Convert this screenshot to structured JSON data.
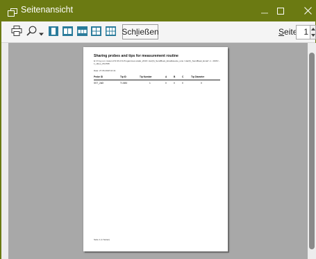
{
  "window": {
    "title": "Seitenansicht",
    "icons": {
      "app": "print-preview-icon",
      "minimize": "minimize-icon",
      "maximize": "maximize-icon",
      "close": "close-icon"
    }
  },
  "toolbar": {
    "icons": [
      "print-icon",
      "zoom-icon",
      "chevron-down-icon",
      "one-page-icon",
      "two-pages-icon",
      "three-pages-icon",
      "four-pages-icon",
      "six-pages-icon"
    ],
    "close_label_prefix": "Sch",
    "close_label_mnemonic": "l",
    "close_label_suffix": "ießen",
    "page_label_mnemonic": "S",
    "page_label_suffix": "eite",
    "page_value": "1"
  },
  "document": {
    "title": "Sharing probes and tips for measurement routine",
    "path": "E:\\ P.xyy.u.m.mssum.FS.SS.0.S.Progammes.scalar_2016 \\ Har(h)_SendBoek_EmailHeeste_unie \\ Har(h)_SendBoek_Email \\ 1 - 000S \\ 1_Hbeo_0S.PR8",
    "date": "Date: 27.06.2018 10:41",
    "columns": [
      "Probe ID",
      "Tip ID",
      "Tip Number",
      "A",
      "B",
      "C",
      "Tip Diameter"
    ],
    "rows": [
      [
        "SST_2a0I",
        "TI-I083",
        "1",
        "0",
        "0",
        "0",
        "0"
      ]
    ],
    "footer": "Seite 1 (1 Seiten)"
  }
}
